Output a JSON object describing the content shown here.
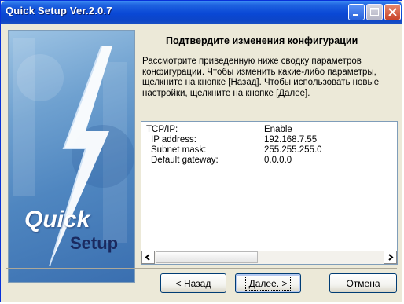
{
  "window": {
    "title": "Quick Setup Ver.2.0.7"
  },
  "banner": {
    "word1": "Quick",
    "word2": "Setup"
  },
  "main": {
    "heading": "Подтвердите изменения конфигурации",
    "description": "Рассмотрите приведенную ниже сводку параметров конфигурации. Чтобы изменить какие-либо параметры, щелкните на кнопке [Назад]. Чтобы использовать новые настройки, щелкните на кнопке [Далее].",
    "summary": [
      {
        "label": "TCP/IP:",
        "value": "Enable"
      },
      {
        "label": "IP address:",
        "value": "192.168.7.55"
      },
      {
        "label": "Subnet mask:",
        "value": "255.255.255.0"
      },
      {
        "label": "Default gateway:",
        "value": "0.0.0.0"
      }
    ]
  },
  "buttons": {
    "back": "< Назад",
    "next": "Далее. >",
    "cancel": "Отмена"
  }
}
